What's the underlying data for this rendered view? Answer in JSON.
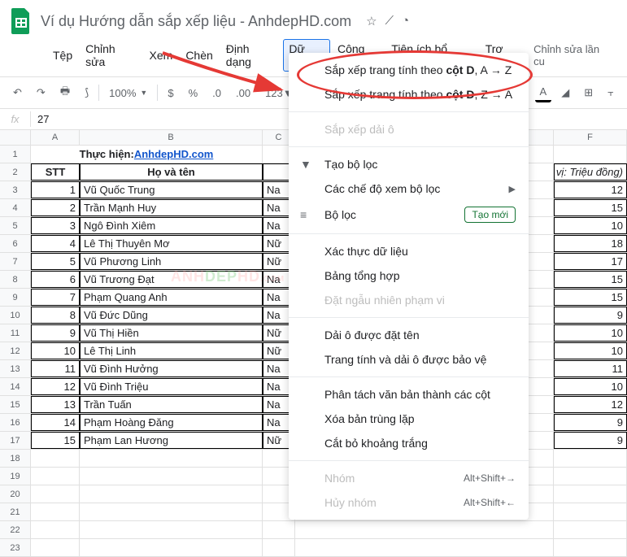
{
  "doc": {
    "title": "Ví dụ Hướng dẫn sắp xếp liệu - AnhdepHD.com"
  },
  "menubar": {
    "file": "Tệp",
    "edit": "Chỉnh sửa",
    "view": "Xem",
    "insert": "Chèn",
    "format": "Định dạng",
    "data": "Dữ liệu",
    "tools": "Công cụ",
    "addons": "Tiện ích bổ sung",
    "help": "Trợ giúp",
    "history": "Chỉnh sửa lần cu"
  },
  "toolbar": {
    "zoom": "100%"
  },
  "fx": {
    "value": "27"
  },
  "cols": {
    "A": "A",
    "B": "B",
    "C": "C",
    "F": "F"
  },
  "sheet": {
    "title_prefix": "Thực hiện: ",
    "title_link": "AnhdepHD.com",
    "h_stt": "STT",
    "h_name": "Họ và tên",
    "h_unit": "n vị: Triệu đồng)",
    "rows": [
      {
        "n": "1",
        "stt": "1",
        "name": "Vũ Quốc Trung",
        "g": "Na",
        "v": "12"
      },
      {
        "n": "2",
        "stt": "2",
        "name": "Trần Mạnh Huy",
        "g": "Na",
        "v": "15"
      },
      {
        "n": "3",
        "stt": "3",
        "name": "Ngô Đình Xiêm",
        "g": "Na",
        "v": "10"
      },
      {
        "n": "4",
        "stt": "4",
        "name": "Lê Thị Thuyên Mơ",
        "g": "Nữ",
        "v": "18"
      },
      {
        "n": "5",
        "stt": "5",
        "name": "Vũ Phương Linh",
        "g": "Nữ",
        "v": "17"
      },
      {
        "n": "6",
        "stt": "6",
        "name": "Vũ Trương Đạt",
        "g": "Na",
        "v": "15"
      },
      {
        "n": "7",
        "stt": "7",
        "name": "Phạm Quang Anh",
        "g": "Na",
        "v": "15"
      },
      {
        "n": "8",
        "stt": "8",
        "name": "Vũ Đức Dũng",
        "g": "Na",
        "v": "9"
      },
      {
        "n": "9",
        "stt": "9",
        "name": "Vũ Thị Hiền",
        "g": "Nữ",
        "v": "10"
      },
      {
        "n": "10",
        "stt": "10",
        "name": "Lê Thị Linh",
        "g": "Nữ",
        "v": "10"
      },
      {
        "n": "11",
        "stt": "11",
        "name": "Vũ Đình Hưởng",
        "g": "Na",
        "v": "11"
      },
      {
        "n": "12",
        "stt": "12",
        "name": "Vũ Đình Triệu",
        "g": "Na",
        "v": "10"
      },
      {
        "n": "13",
        "stt": "13",
        "name": "Trần Tuấn",
        "g": "Na",
        "v": "12"
      },
      {
        "n": "14",
        "stt": "14",
        "name": "Phạm Hoàng Đăng",
        "g": "Na",
        "v": "9"
      },
      {
        "n": "15",
        "stt": "15",
        "name": "Phạm Lan Hương",
        "g": "Nữ",
        "v": "9"
      }
    ],
    "empty_rows": [
      "18",
      "19",
      "20",
      "21",
      "22",
      "23"
    ]
  },
  "dropdown": {
    "sort_az_pre": "Sắp xếp trang tính theo ",
    "sort_az_col": "cột D",
    "sort_az_suf": ", A → Z",
    "sort_za_pre": "Sắp xếp trang tính theo ",
    "sort_za_col": "cột D",
    "sort_za_suf": ", Z → A",
    "sort_range": "Sắp xếp dải ô",
    "create_filter": "Tạo bộ lọc",
    "filter_views": "Các chế độ xem bộ lọc",
    "slicer": "Bộ lọc",
    "slicer_badge": "Tạo mới",
    "data_validation": "Xác thực dữ liệu",
    "pivot": "Bảng tổng hợp",
    "randomize": "Đặt ngẫu nhiên phạm vi",
    "named_ranges": "Dải ô được đặt tên",
    "protect": "Trang tính và dải ô được bảo vệ",
    "split_text": "Phân tách văn bản thành các cột",
    "remove_dup": "Xóa bản trùng lặp",
    "trim": "Cắt bỏ khoảng trắng",
    "group": "Nhóm",
    "group_sc": "Alt+Shift+→",
    "ungroup": "Hủy nhóm",
    "ungroup_sc": "Alt+Shift+←"
  }
}
